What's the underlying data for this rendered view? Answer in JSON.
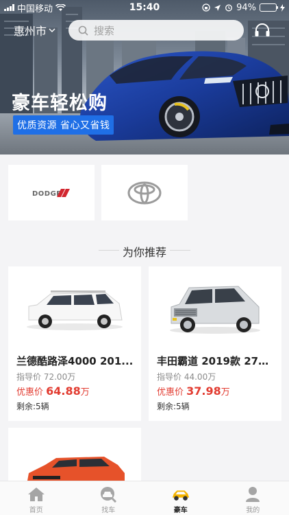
{
  "status_bar": {
    "carrier": "中国移动",
    "time": "15:40",
    "battery": "94%",
    "battery_level": 0.94
  },
  "header": {
    "city": "惠州市",
    "search_placeholder": "搜索"
  },
  "banner": {
    "title": "豪车轻松购",
    "tagline": "优质资源  省心又省钱"
  },
  "brands": [
    {
      "name": "DODGE"
    },
    {
      "name": "TOYOTA"
    }
  ],
  "recommend": {
    "section_title": "为你推荐",
    "items": [
      {
        "name": "兰德酷路泽4000 201...",
        "guide_label": "指导价",
        "guide_price": "72.00万",
        "sale_label": "优惠价",
        "sale_price": "64.88",
        "sale_unit": "万",
        "stock": "剩余:5辆",
        "car_color": "white"
      },
      {
        "name": "丰田霸道 2019款 270...",
        "guide_label": "指导价",
        "guide_price": "44.00万",
        "sale_label": "优惠价",
        "sale_price": "37.98",
        "sale_unit": "万",
        "stock": "剩余:5辆",
        "car_color": "silver"
      },
      {
        "car_color": "orange"
      }
    ]
  },
  "tabbar": {
    "tabs": [
      {
        "label": "首页",
        "icon": "home-icon",
        "active": false
      },
      {
        "label": "找车",
        "icon": "find-car-icon",
        "active": false
      },
      {
        "label": "豪车",
        "icon": "luxury-car-icon",
        "active": true
      },
      {
        "label": "我的",
        "icon": "profile-icon",
        "active": false
      }
    ],
    "active_color": "#f5b400"
  },
  "colors": {
    "accent_red": "#e23b30",
    "tag_blue": "#1f6fe6",
    "battery_green": "#35d04d"
  }
}
